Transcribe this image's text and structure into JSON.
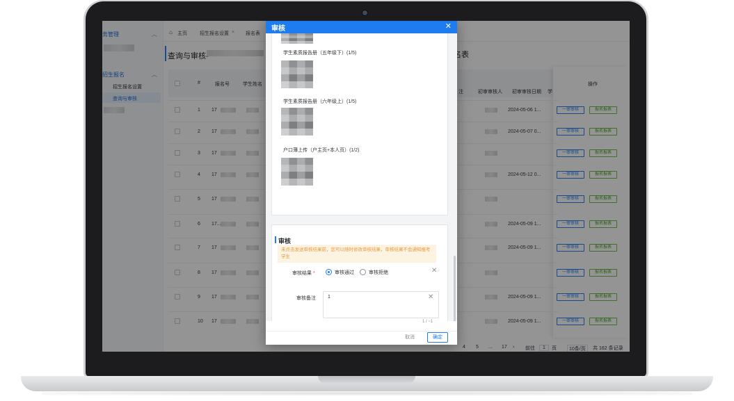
{
  "sidebar": {
    "group1": "务管理",
    "group2": "招生报名",
    "items": [
      "招生报名设置",
      "查询与审核"
    ]
  },
  "tabs": [
    "主页",
    "招生报名设置",
    "报名表"
  ],
  "page": {
    "title_left": "查询与审核-",
    "title_right": "名表"
  },
  "table": {
    "headers": [
      "#",
      "报名号",
      "学生姓名",
      "注",
      "初审审核人",
      "初审审核日期",
      "学",
      "操作"
    ],
    "rows": [
      {
        "no": "1",
        "id": "17",
        "date": "2024-05-06 1..."
      },
      {
        "no": "2",
        "id": "17",
        "date": "2024-05-07 0..."
      },
      {
        "no": "3",
        "id": "17",
        "date": ""
      },
      {
        "no": "4",
        "id": "17",
        "date": "2024-05-12 0..."
      },
      {
        "no": "5",
        "id": "17",
        "date": ""
      },
      {
        "no": "6",
        "id": "17...84...",
        "date": "2024-05-09 1..."
      },
      {
        "no": "7",
        "id": "17",
        "date": "2024-05-09 1..."
      },
      {
        "no": "8",
        "id": "17",
        "date": ""
      },
      {
        "no": "9",
        "id": "17",
        "date": "2024-05-09 1..."
      },
      {
        "no": "10",
        "id": "17",
        "date": "2024-05-09 1..."
      }
    ],
    "btn_review": "一审审核",
    "btn_view": "报名报表"
  },
  "pager": {
    "pages": [
      "4",
      "5",
      "...",
      "17"
    ],
    "goto": "前往",
    "page": "1",
    "unit": "页",
    "size": "10条/页",
    "total": "共 162 条记录"
  },
  "modal": {
    "title": "审核",
    "close": "✕",
    "files": [
      "学生素质报告册（五年级下）(1/5)",
      "学生素质报告册（六年级上）(1/5)",
      "户口薄上传（户主页+本人页）(1/2)"
    ],
    "section": "审核",
    "warning": "未点击发送审核结果前，您可以随时修改审核结果，审核结果不会通知报考学生",
    "result_label": "审核结果",
    "required": "*",
    "options": [
      "审核通过",
      "审核拒绝"
    ],
    "remark_label": "审核备注",
    "remark_value": "1",
    "counter": "1 / ~1",
    "cancel": "取消",
    "ok": "确定"
  }
}
